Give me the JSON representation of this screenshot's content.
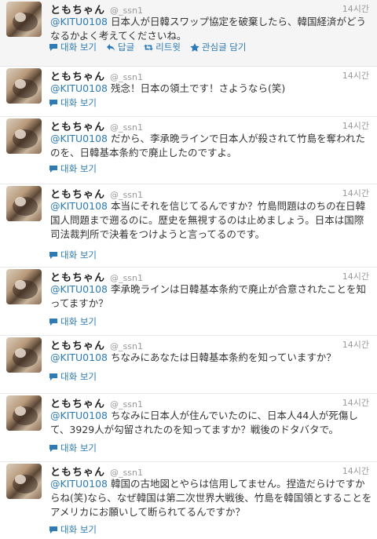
{
  "tweets": [
    {
      "name": "ともちゃん",
      "handle": "@_ssn1",
      "time": "14시간",
      "mention": "@KITU0108",
      "text": " 日本人が日韓スワップ協定を破棄したら、韓国経済がどうなるかよく考えてくださいね。",
      "actions": [
        "대화 보기",
        "답글",
        "리트윗",
        "관심글 담기"
      ]
    },
    {
      "name": "ともちゃん",
      "handle": "@_ssn1",
      "time": "14시간",
      "mention": "@KITU0108",
      "text": " 残念！日本の領土です！さようなら(笑)",
      "actions": [
        "대화 보기"
      ]
    },
    {
      "name": "ともちゃん",
      "handle": "@_ssn1",
      "time": "14시간",
      "mention": "@KITU0108",
      "text": " だから、李承晩ラインで日本人が殺されて竹島を奪われたのを、日韓基本条約で廃止したのですよ。",
      "actions": [
        "대화 보기"
      ]
    },
    {
      "name": "ともちゃん",
      "handle": "@_ssn1",
      "time": "14시간",
      "mention": "@KITU0108",
      "text": " 本当にそれを信じてるんですか？竹島問題はのちの在日韓国人問題まで遡るのに。歴史を無視するのは止めましょう。日本は国際司法裁判所で決着をつけようと言ってるのです。",
      "actions": [
        "대화 보기"
      ]
    },
    {
      "name": "ともちゃん",
      "handle": "@_ssn1",
      "time": "14시간",
      "mention": "@KITU0108",
      "text": " 李承晩ラインは日韓基本条約で廃止が合意されたことを知ってますか？",
      "actions": [
        "대화 보기"
      ]
    },
    {
      "name": "ともちゃん",
      "handle": "@_ssn1",
      "time": "14시간",
      "mention": "@KITU0108",
      "text": " ちなみにあなたは日韓基本条約を知っていますか？",
      "actions": [
        "대화 보기"
      ]
    },
    {
      "name": "ともちゃん",
      "handle": "@_ssn1",
      "time": "14시간",
      "mention": "@KITU0108",
      "text": " ちなみに日本人が住んでいたのに、日本人44人が死傷して、3929人が勾留されたのを知ってますか？戦後のドタバタで。",
      "actions": [
        "대화 보기"
      ]
    },
    {
      "name": "ともちゃん",
      "handle": "@_ssn1",
      "time": "14시간",
      "mention": "@KITU0108",
      "text": " 韓国の古地図とやらは信用してません。捏造だらけですからね(笑)なら、なぜ韓国は第二次世界大戦後、竹島を韓国領とすることをアメリカにお願いして断られてるんですか？",
      "actions": [
        "대화 보기"
      ]
    }
  ],
  "colors": {
    "link": "#2b7bb9",
    "meta": "#999999",
    "highlight": "#f5f5f5"
  },
  "icons": {
    "view": "speech-bubble-icon",
    "reply": "reply-arrow-icon",
    "retweet": "retweet-icon",
    "favorite": "star-icon"
  }
}
